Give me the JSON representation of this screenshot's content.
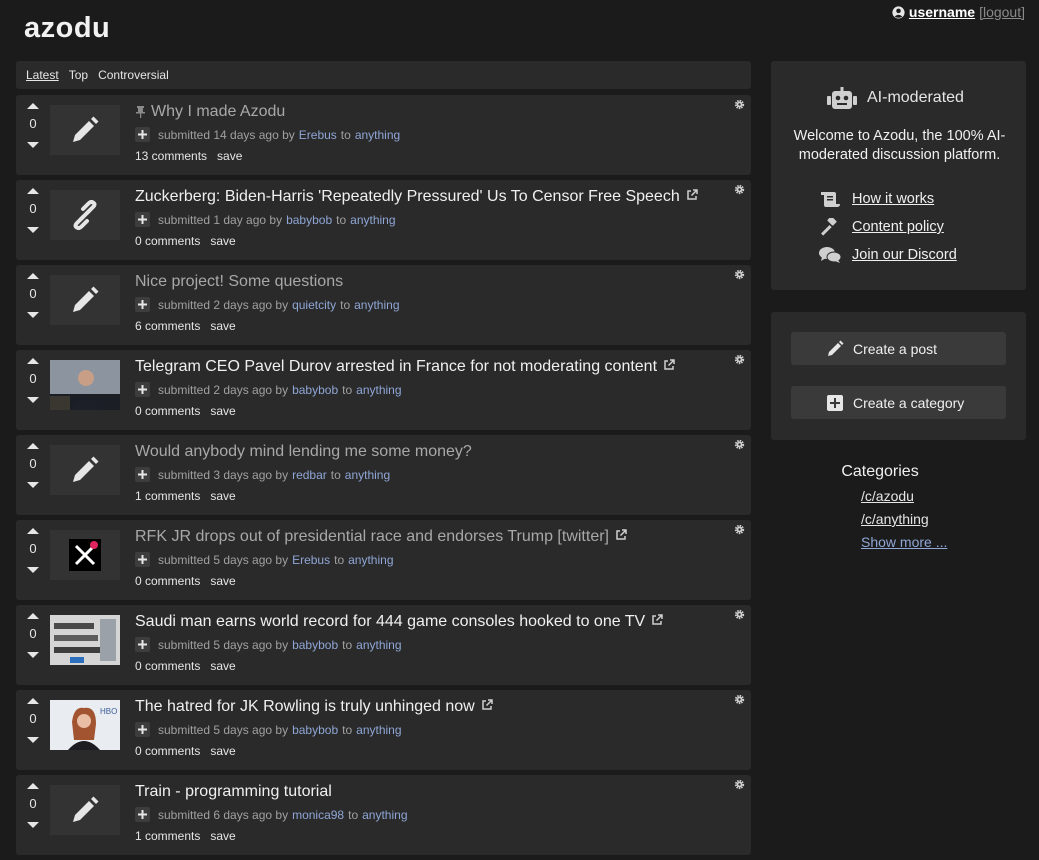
{
  "app": {
    "logo": "azodu"
  },
  "user": {
    "username": "username",
    "logout": "[logout]"
  },
  "sort": {
    "tabs": [
      "Latest",
      "Top",
      "Controversial"
    ],
    "active": "Latest"
  },
  "posts": [
    {
      "title": "Why I made Azodu",
      "pinned": true,
      "read": true,
      "external": false,
      "thumb": "pencil-icon",
      "score": "0",
      "submitted": "submitted 14 days ago by",
      "author": "Erebus",
      "to": "to",
      "category": "anything",
      "comments": "13 comments",
      "save": "save"
    },
    {
      "title": "Zuckerberg: Biden-Harris 'Repeatedly Pressured' Us To Censor Free Speech",
      "pinned": false,
      "read": false,
      "external": true,
      "thumb": "link-icon",
      "score": "0",
      "submitted": "submitted 1 day ago by",
      "author": "babybob",
      "to": "to",
      "category": "anything",
      "comments": "0 comments",
      "save": "save"
    },
    {
      "title": "Nice project! Some questions",
      "pinned": false,
      "read": true,
      "external": false,
      "thumb": "pencil-icon",
      "score": "0",
      "submitted": "submitted 2 days ago by",
      "author": "quietcity",
      "to": "to",
      "category": "anything",
      "comments": "6 comments",
      "save": "save"
    },
    {
      "title": "Telegram CEO Pavel Durov arrested in France for not moderating content",
      "pinned": false,
      "read": false,
      "external": true,
      "thumb": "photo-portrait",
      "score": "0",
      "submitted": "submitted 2 days ago by",
      "author": "babybob",
      "to": "to",
      "category": "anything",
      "comments": "0 comments",
      "save": "save"
    },
    {
      "title": "Would anybody mind lending me some money?",
      "pinned": false,
      "read": true,
      "external": false,
      "thumb": "pencil-icon",
      "score": "0",
      "submitted": "submitted 3 days ago by",
      "author": "redbar",
      "to": "to",
      "category": "anything",
      "comments": "1 comments",
      "save": "save"
    },
    {
      "title": "RFK JR drops out of presidential race and endorses Trump [twitter]",
      "pinned": false,
      "read": true,
      "external": true,
      "thumb": "x-logo",
      "score": "0",
      "submitted": "submitted 5 days ago by",
      "author": "Erebus",
      "to": "to",
      "category": "anything",
      "comments": "0 comments",
      "save": "save"
    },
    {
      "title": "Saudi man earns world record for 444 game consoles hooked to one TV",
      "pinned": false,
      "read": false,
      "external": true,
      "thumb": "photo-consoles",
      "score": "0",
      "submitted": "submitted 5 days ago by",
      "author": "babybob",
      "to": "to",
      "category": "anything",
      "comments": "0 comments",
      "save": "save"
    },
    {
      "title": "The hatred for JK Rowling is truly unhinged now",
      "pinned": false,
      "read": false,
      "external": true,
      "thumb": "photo-woman",
      "score": "0",
      "submitted": "submitted 5 days ago by",
      "author": "babybob",
      "to": "to",
      "category": "anything",
      "comments": "0 comments",
      "save": "save"
    },
    {
      "title": "Train - programming tutorial",
      "pinned": false,
      "read": false,
      "external": false,
      "thumb": "pencil-icon",
      "score": "0",
      "submitted": "submitted 6 days ago by",
      "author": "monica98",
      "to": "to",
      "category": "anything",
      "comments": "1 comments",
      "save": "save"
    }
  ],
  "sidebar": {
    "ai_title": "AI-moderated",
    "welcome": "Welcome to Azodu, the 100% AI-moderated discussion platform.",
    "links": [
      {
        "label": "How it works",
        "icon": "scroll-icon"
      },
      {
        "label": "Content policy",
        "icon": "gavel-icon"
      },
      {
        "label": "Join our Discord",
        "icon": "comments-icon"
      }
    ],
    "create_post": "Create a post",
    "create_category": "Create a category",
    "categories_title": "Categories",
    "categories": [
      "/c/azodu",
      "/c/anything"
    ],
    "show_more": "Show more ..."
  },
  "colors": {
    "background": "#1b1b1b",
    "card": "#2a2a2a",
    "link": "#8fa6d6"
  }
}
